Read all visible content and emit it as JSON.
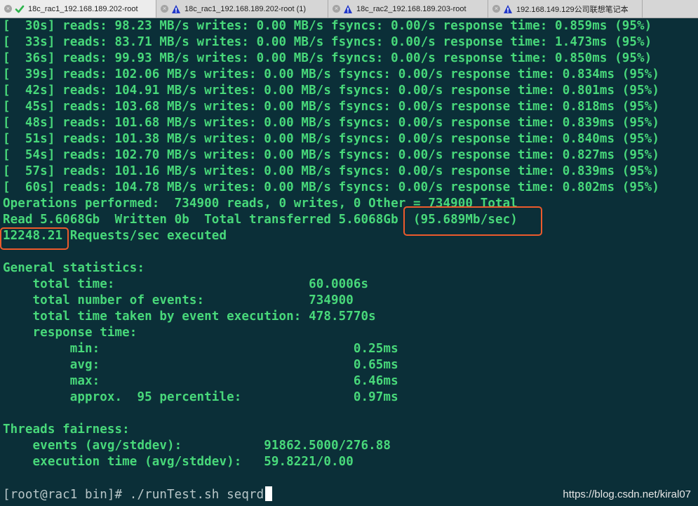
{
  "tabs": [
    {
      "label": "18c_rac1_192.168.189.202-root",
      "status": "check-icon",
      "active": true
    },
    {
      "label": "18c_rac1_192.168.189.202-root (1)",
      "status": "warning-icon",
      "active": false
    },
    {
      "label": "18c_rac2_192.168.189.203-root",
      "status": "warning-icon",
      "active": false
    },
    {
      "label": "192.168.149.129公司联想笔记本",
      "status": "warning-icon",
      "active": false
    }
  ],
  "terminal": {
    "lines": [
      "[  30s] reads: 98.23 MB/s writes: 0.00 MB/s fsyncs: 0.00/s response time: 0.859ms (95%)",
      "[  33s] reads: 83.71 MB/s writes: 0.00 MB/s fsyncs: 0.00/s response time: 1.473ms (95%)",
      "[  36s] reads: 99.93 MB/s writes: 0.00 MB/s fsyncs: 0.00/s response time: 0.850ms (95%)",
      "[  39s] reads: 102.06 MB/s writes: 0.00 MB/s fsyncs: 0.00/s response time: 0.834ms (95%)",
      "[  42s] reads: 104.91 MB/s writes: 0.00 MB/s fsyncs: 0.00/s response time: 0.801ms (95%)",
      "[  45s] reads: 103.68 MB/s writes: 0.00 MB/s fsyncs: 0.00/s response time: 0.818ms (95%)",
      "[  48s] reads: 101.68 MB/s writes: 0.00 MB/s fsyncs: 0.00/s response time: 0.839ms (95%)",
      "[  51s] reads: 101.38 MB/s writes: 0.00 MB/s fsyncs: 0.00/s response time: 0.840ms (95%)",
      "[  54s] reads: 102.70 MB/s writes: 0.00 MB/s fsyncs: 0.00/s response time: 0.827ms (95%)",
      "[  57s] reads: 101.16 MB/s writes: 0.00 MB/s fsyncs: 0.00/s response time: 0.839ms (95%)",
      "[  60s] reads: 104.78 MB/s writes: 0.00 MB/s fsyncs: 0.00/s response time: 0.802ms (95%)",
      "Operations performed:  734900 reads, 0 writes, 0 Other = 734900 Total",
      "Read 5.6068Gb  Written 0b  Total transferred 5.6068Gb  (95.689Mb/sec)",
      "12248.21 Requests/sec executed",
      "",
      "General statistics:",
      "    total time:                          60.0006s",
      "    total number of events:              734900",
      "    total time taken by event execution: 478.5770s",
      "    response time:",
      "         min:                                  0.25ms",
      "         avg:                                  0.65ms",
      "         max:                                  6.46ms",
      "         approx.  95 percentile:               0.97ms",
      "",
      "Threads fairness:",
      "    events (avg/stddev):           91862.5000/276.88",
      "    execution time (avg/stddev):   59.8221/0.00",
      ""
    ],
    "prompt": "[root@rac1 bin]# ./runTest.sh seqrd"
  },
  "watermark": "https://blog.csdn.net/kiral07",
  "colors": {
    "background": "#0b2f38",
    "text": "#48d87a",
    "highlight": "#ec5a2c"
  }
}
